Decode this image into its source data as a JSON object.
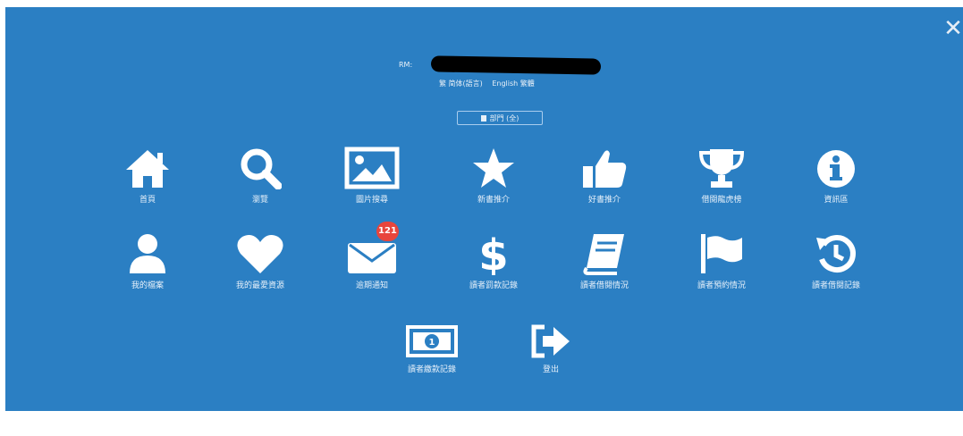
{
  "header": {
    "account_prefix": "RM:",
    "languages": [
      "繁 简体(語言)",
      "English 繁體"
    ],
    "department_label": "部門 (全)"
  },
  "menu": {
    "row1": [
      {
        "label": "首頁",
        "icon": "home-icon"
      },
      {
        "label": "瀏覽",
        "icon": "search-icon"
      },
      {
        "label": "圖片搜尋",
        "icon": "picture-icon"
      },
      {
        "label": "新書推介",
        "icon": "star-icon"
      },
      {
        "label": "好書推介",
        "icon": "thumbs-up-icon"
      },
      {
        "label": "借閱龍虎榜",
        "icon": "trophy-icon"
      },
      {
        "label": "資訊區",
        "icon": "info-icon"
      }
    ],
    "row2": [
      {
        "label": "我的檔案",
        "icon": "user-icon"
      },
      {
        "label": "我的最愛資源",
        "icon": "heart-icon"
      },
      {
        "label": "逾期通知",
        "icon": "envelope-icon",
        "badge": "121"
      },
      {
        "label": "讀者罰款記錄",
        "icon": "dollar-icon"
      },
      {
        "label": "讀者借閱情況",
        "icon": "book-icon"
      },
      {
        "label": "讀者預約情況",
        "icon": "flag-icon"
      },
      {
        "label": "讀者借閱記錄",
        "icon": "history-icon"
      }
    ],
    "row3": [
      {
        "label": "讀者繳款記錄",
        "icon": "money-icon"
      },
      {
        "label": "登出",
        "icon": "sign-out-icon"
      }
    ]
  },
  "colors": {
    "panel": "#2b7fc3",
    "icon": "#ffffff",
    "badge": "#e8453c"
  }
}
